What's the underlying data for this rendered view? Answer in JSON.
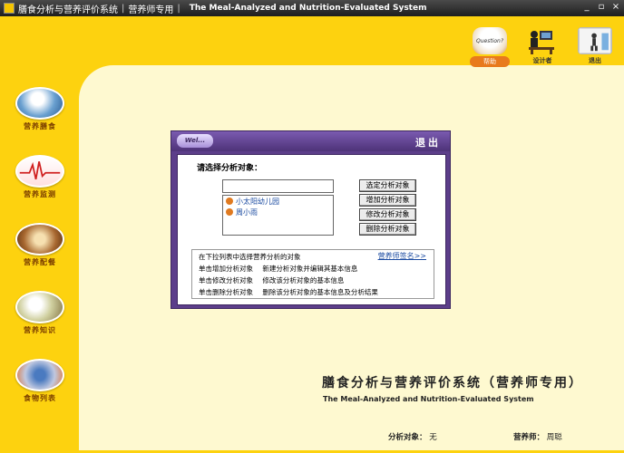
{
  "titlebar": {
    "title": "膳食分析与营养评价系统",
    "edition": "营养师专用",
    "english": "The Meal-Analyzed and Nutrition-Evaluated System",
    "minimize": "_",
    "restore": "▫",
    "close": "×"
  },
  "top_icons": {
    "help_bubble": "Question?",
    "help_label": "帮助",
    "designer_label": "设计者",
    "exit_label": "退出"
  },
  "nav": {
    "items": [
      {
        "label": "营养膳食"
      },
      {
        "label": "营养监测"
      },
      {
        "label": "营养配餐"
      },
      {
        "label": "营养知识"
      },
      {
        "label": "食物列表"
      }
    ]
  },
  "dialog": {
    "logo": "Wel...",
    "exit": "退出",
    "prompt": "请选择分析对象：",
    "input_value": "",
    "list": [
      "小太阳幼儿园",
      "周小雨"
    ],
    "buttons": [
      "选定分析对象",
      "增加分析对象",
      "修改分析对象",
      "删除分析对象"
    ],
    "help_link": "营养师签名>>",
    "help_lines": [
      {
        "action": "在下拉列表中选择营养分析的对象",
        "desc": ""
      },
      {
        "action": "单击增加分析对象",
        "desc": "新建分析对象并编辑其基本信息"
      },
      {
        "action": "单击修改分析对象",
        "desc": "修改该分析对象的基本信息"
      },
      {
        "action": "单击删除分析对象",
        "desc": "删除该分析对象的基本信息及分析结果"
      }
    ]
  },
  "footer": {
    "system_title": "膳食分析与营养评价系统（营养师专用）",
    "system_english": "The Meal-Analyzed and Nutrition-Evaluated System",
    "object_label": "分析对象：",
    "object_value": "无",
    "nutritionist_label": "营养师：",
    "nutritionist_value": "周聪"
  },
  "colors": {
    "frame": "#fdd20f",
    "content": "#fef9d0",
    "dialog": "#5c3e8a",
    "link": "#1a4aa0"
  }
}
